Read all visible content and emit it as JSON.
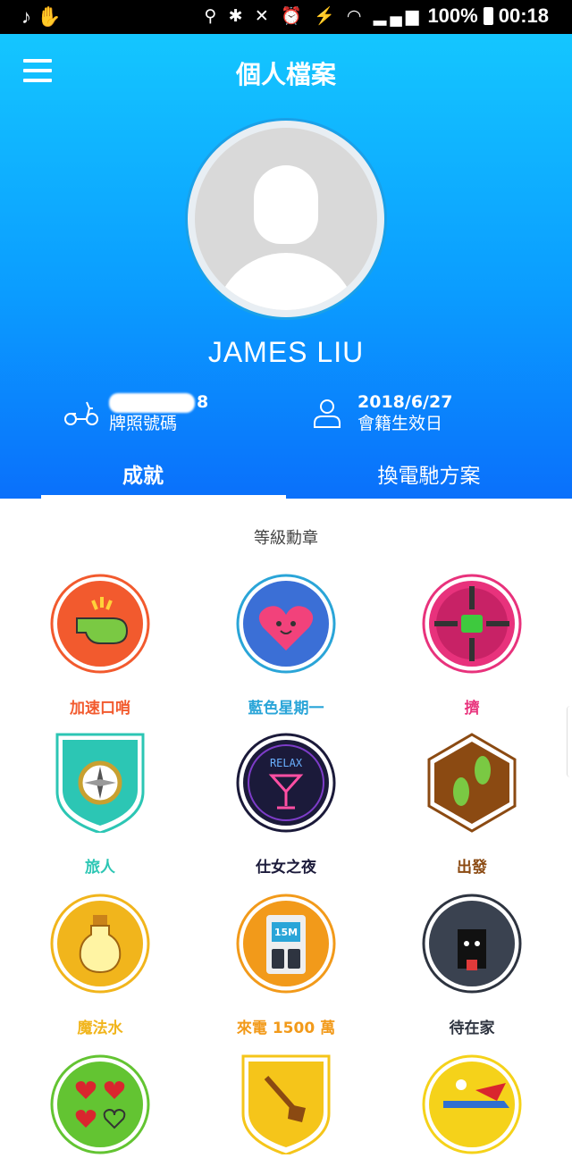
{
  "status_bar": {
    "left_icons": "♪ ✋",
    "right_icons": "⚲ ✱ ✕ ⏰ ⚡ ◠ ▂▄▆",
    "battery": "100%",
    "time": "00:18"
  },
  "header": {
    "menu_icon": "hamburger-menu-icon",
    "title": "個人檔案"
  },
  "profile": {
    "name": "JAMES LIU",
    "plate": {
      "value": "8",
      "label": "牌照號碼"
    },
    "membership": {
      "value": "2018/6/27",
      "label": "會籍生效日"
    }
  },
  "tabs": [
    {
      "label": "成就",
      "active": true
    },
    {
      "label": "換電馳方案",
      "active": false
    }
  ],
  "section_title": "等級勳章",
  "badges": [
    {
      "label": "加速口哨",
      "color": "#f25a2e"
    },
    {
      "label": "藍色星期一",
      "color": "#2aa5d8"
    },
    {
      "label": "擠",
      "color": "#e8327c"
    },
    {
      "label": "旅人",
      "color": "#2cc6b4"
    },
    {
      "label": "仕女之夜",
      "color": "#1b1a3a"
    },
    {
      "label": "出發",
      "color": "#8b4a12"
    },
    {
      "label": "魔法水",
      "color": "#f1b51c"
    },
    {
      "label": "來電 1500 萬",
      "color": "#f29a1a"
    },
    {
      "label": "待在家",
      "color": "#2e3440"
    },
    {
      "label": "",
      "color": "#63c432"
    },
    {
      "label": "",
      "color": "#f5c51a"
    },
    {
      "label": "",
      "color": "#f5d21a"
    }
  ]
}
